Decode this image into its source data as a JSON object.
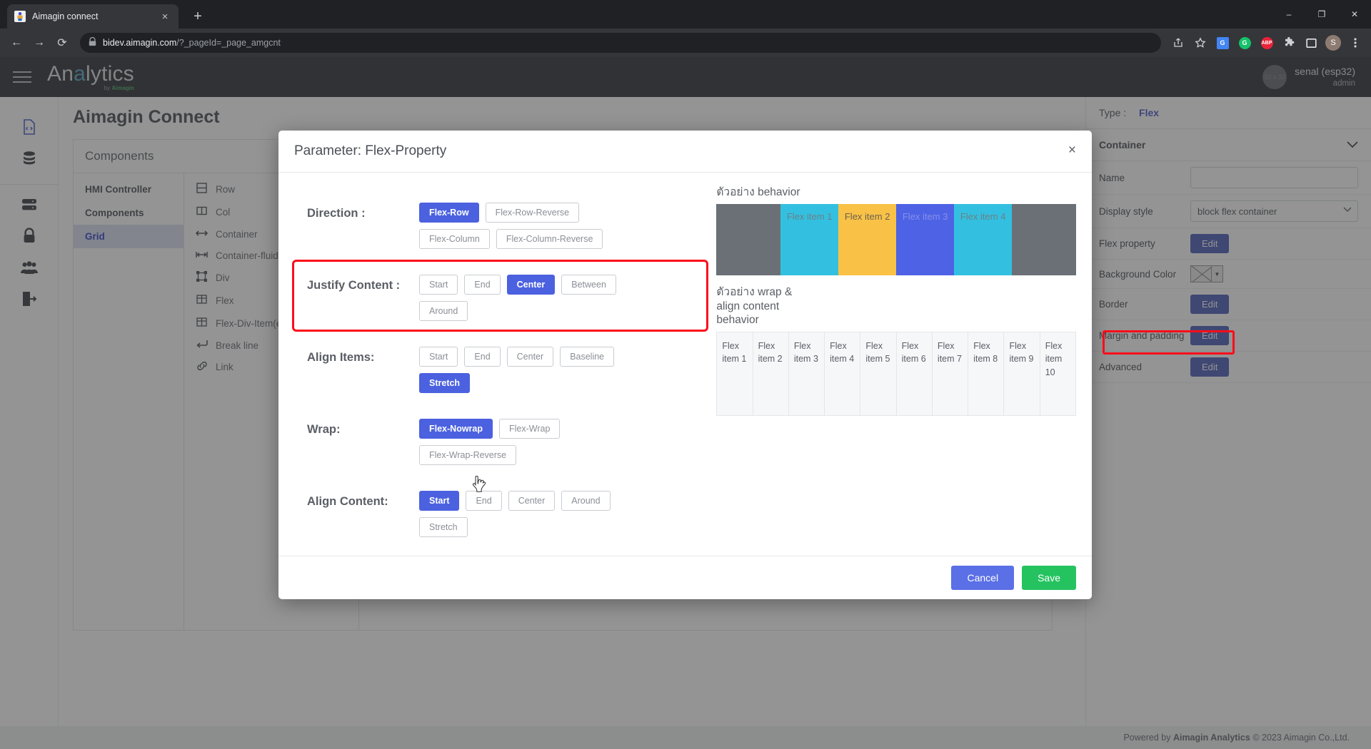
{
  "browser": {
    "tab": {
      "title": "Aimagin connect",
      "close_label": "×"
    },
    "newtab_label": "+",
    "window_controls": {
      "minimize": "–",
      "maximize": "❐",
      "close": "✕"
    },
    "nav": {
      "back": "←",
      "forward": "→",
      "reload": "⟳"
    },
    "omnibox": {
      "lock": "🔒",
      "url_domain": "bidev.aimagin.com",
      "url_path": "/?_pageId=_page_amgcnt"
    },
    "toolbar_icons": [
      "share-icon",
      "bookmark-star-icon",
      "google-translate-icon",
      "grammarly-icon",
      "adblock-plus-icon",
      "extensions-puzzle-icon",
      "sidepanel-icon",
      "profile-avatar",
      "chrome-menu-icon"
    ],
    "extension_labels": {
      "translate": "G",
      "grammarly": "G",
      "adblock": "ABP",
      "profile": "S"
    }
  },
  "app": {
    "brand": {
      "name_part1": "An",
      "name_accent": "a",
      "name_part2": "lytics",
      "sub_prefix": "by ",
      "sub_brand": "Aimagin"
    },
    "user": {
      "avatar_text": "32 x 32",
      "name": "senal (esp32)",
      "role": "admin"
    },
    "page_title": "Aimagin Connect",
    "rail_icons": [
      "file-code-icon",
      "database-icon",
      "server-icon",
      "lock-icon",
      "users-icon",
      "logout-icon"
    ],
    "panel": {
      "header": "Components",
      "categories": [
        {
          "label": "HMI Controller",
          "active": false
        },
        {
          "label": "Components",
          "active": false
        },
        {
          "label": "Grid",
          "active": true
        }
      ],
      "widgets": [
        {
          "icon": "row-icon",
          "label": "Row"
        },
        {
          "icon": "col-icon",
          "label": "Col"
        },
        {
          "icon": "container-icon",
          "label": "Container"
        },
        {
          "icon": "container-fluid-icon",
          "label": "Container-fluid"
        },
        {
          "icon": "div-icon",
          "label": "Div"
        },
        {
          "icon": "flex-icon",
          "label": "Flex"
        },
        {
          "icon": "flex-div-item-icon",
          "label": "Flex-Div-Item(exp"
        },
        {
          "icon": "break-line-icon",
          "label": "Break line"
        },
        {
          "icon": "link-icon",
          "label": "Link"
        }
      ]
    },
    "right_panel": {
      "type_label": "Type :",
      "type_value": "Flex",
      "section_title": "Container",
      "rows": [
        {
          "label": "Name",
          "control": "input",
          "value": ""
        },
        {
          "label": "Display style",
          "control": "select",
          "value": "block flex container"
        },
        {
          "label": "Flex property",
          "control": "button",
          "value": "Edit"
        },
        {
          "label": "Background Color",
          "control": "color",
          "value": ""
        },
        {
          "label": "Border",
          "control": "button",
          "value": "Edit"
        },
        {
          "label": "Margin and padding",
          "control": "button",
          "value": "Edit"
        },
        {
          "label": "Advanced",
          "control": "button",
          "value": "Edit"
        }
      ]
    },
    "footer": {
      "prefix": "Powered by ",
      "brand": "Aimagin Analytics",
      "suffix": " © 2023 Aimagin Co.,Ltd."
    }
  },
  "modal": {
    "title": "Parameter: Flex-Property",
    "close_label": "×",
    "groups": [
      {
        "key": "direction",
        "label": "Direction :",
        "highlighted": false,
        "options": [
          {
            "label": "Flex-Row",
            "selected": true
          },
          {
            "label": "Flex-Row-Reverse",
            "selected": false
          },
          {
            "label": "Flex-Column",
            "selected": false
          },
          {
            "label": "Flex-Column-Reverse",
            "selected": false
          }
        ]
      },
      {
        "key": "justify_content",
        "label": "Justify Content :",
        "highlighted": true,
        "options": [
          {
            "label": "Start",
            "selected": false
          },
          {
            "label": "End",
            "selected": false
          },
          {
            "label": "Center",
            "selected": true
          },
          {
            "label": "Between",
            "selected": false
          },
          {
            "label": "Around",
            "selected": false
          }
        ]
      },
      {
        "key": "align_items",
        "label": "Align Items:",
        "highlighted": false,
        "options": [
          {
            "label": "Start",
            "selected": false
          },
          {
            "label": "End",
            "selected": false
          },
          {
            "label": "Center",
            "selected": false
          },
          {
            "label": "Baseline",
            "selected": false
          },
          {
            "label": "Stretch",
            "selected": true
          }
        ]
      },
      {
        "key": "wrap",
        "label": "Wrap:",
        "highlighted": false,
        "options": [
          {
            "label": "Flex-Nowrap",
            "selected": true
          },
          {
            "label": "Flex-Wrap",
            "selected": false
          },
          {
            "label": "Flex-Wrap-Reverse",
            "selected": false
          }
        ]
      },
      {
        "key": "align_content",
        "label": "Align Content:",
        "highlighted": false,
        "options": [
          {
            "label": "Start",
            "selected": true
          },
          {
            "label": "End",
            "selected": false
          },
          {
            "label": "Center",
            "selected": false
          },
          {
            "label": "Around",
            "selected": false
          },
          {
            "label": "Stretch",
            "selected": false
          }
        ]
      }
    ],
    "preview_behavior": {
      "title": "ตัวอย่าง behavior",
      "items": [
        {
          "label": "Flex item 1",
          "color": "#33c0e0",
          "text_color": "#6e7f86"
        },
        {
          "label": "Flex item 2",
          "color": "#f9c246",
          "text_color": "#6a6152"
        },
        {
          "label": "Flex item 3",
          "color": "#4e62e6",
          "text_color": "#8490ea"
        },
        {
          "label": "Flex item 4",
          "color": "#33c0e0",
          "text_color": "#6e7f86"
        }
      ],
      "track_color": "#6b7077"
    },
    "preview_wrap": {
      "title": "ตัวอย่าง wrap & align content behavior",
      "items": [
        "Flex item 1",
        "Flex item 2",
        "Flex item 3",
        "Flex item 4",
        "Flex item 5",
        "Flex item 6",
        "Flex item 7",
        "Flex item 8",
        "Flex item 9",
        "Flex item 10"
      ]
    },
    "footer": {
      "cancel": "Cancel",
      "save": "Save"
    }
  },
  "colors": {
    "accent_blue": "#4b61e0",
    "save_green": "#24c360",
    "cancel_blue": "#5b6fe6",
    "annotation_red": "#fc0d1b",
    "edit_button": "#3f51b5"
  }
}
